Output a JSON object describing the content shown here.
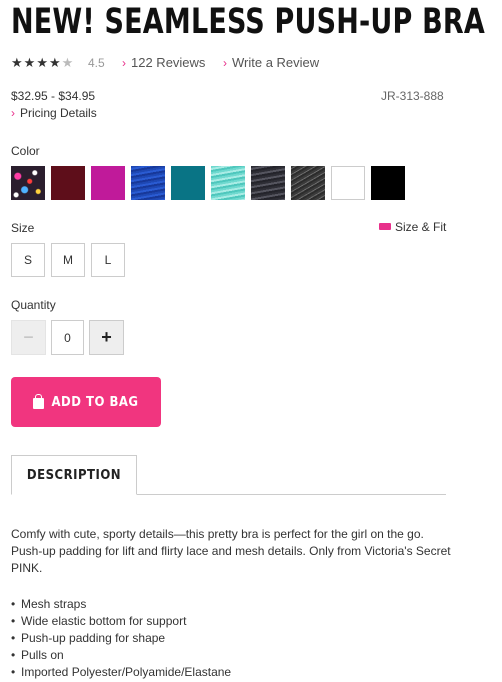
{
  "product": {
    "title": "NEW! SEAMLESS PUSH-UP BRA",
    "rating": "4.5",
    "reviews_link": "122 Reviews",
    "write_review_link": "Write a Review",
    "price": "$32.95 - $34.95",
    "sku": "JR-313-888",
    "pricing_details_link": "Pricing Details"
  },
  "color": {
    "label": "Color",
    "swatches": [
      {
        "name": "multicolor-sequin",
        "color": "#2b1e2e"
      },
      {
        "name": "burgundy",
        "color": "#5e0e1a"
      },
      {
        "name": "magenta",
        "color": "#c01a9a"
      },
      {
        "name": "royal-blue-space-dye",
        "color": "#1e48b4"
      },
      {
        "name": "teal",
        "color": "#097485"
      },
      {
        "name": "aqua-space-dye",
        "color": "#6fd9cf"
      },
      {
        "name": "charcoal-space-dye",
        "color": "#3a3a42"
      },
      {
        "name": "grey-marl",
        "color": "#4a4a4a"
      },
      {
        "name": "white",
        "color": "#ffffff"
      },
      {
        "name": "black",
        "color": "#000000"
      }
    ]
  },
  "size": {
    "label": "Size",
    "fit_link": "Size & Fit",
    "options": [
      "S",
      "M",
      "L"
    ]
  },
  "quantity": {
    "label": "Quantity",
    "value": "0",
    "minus": "−",
    "plus": "+"
  },
  "add_to_bag": "ADD TO BAG",
  "tabs": {
    "description": "DESCRIPTION"
  },
  "description": {
    "text": "Comfy with cute, sporty details—this pretty bra is perfect for the girl on the go. Push-up padding for lift and flirty lace and mesh details. Only from Victoria's Secret PINK.",
    "bullets": [
      "Mesh straps",
      "Wide elastic bottom for support",
      "Push-up padding for shape",
      "Pulls on",
      "Imported Polyester/Polyamide/Elastane"
    ]
  },
  "accent_color": "#f1357f"
}
